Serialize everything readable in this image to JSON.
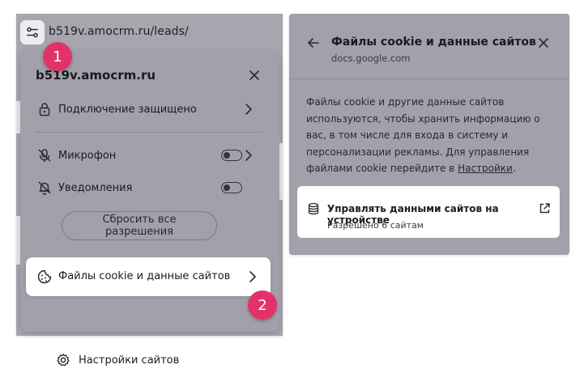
{
  "site_info": {
    "url": "b519v.amocrm.ru/leads/",
    "site_name": "b519v.amocrm.ru",
    "connection_label": "Подключение защищено",
    "permissions": [
      {
        "label": "Микрофон",
        "icon": "microphone-off-icon",
        "enabled": false
      },
      {
        "label": "Уведомления",
        "icon": "notifications-off-icon",
        "enabled": false
      }
    ],
    "reset_button": "Сбросить все разрешения",
    "cookies_label": "Файлы cookie и данные сайтов",
    "site_settings_label": "Настройки сайтов"
  },
  "steps": {
    "one": "1",
    "two": "2"
  },
  "cookie_panel": {
    "title": "Файлы cookie и данные сайтов",
    "subtitle": "docs.google.com",
    "description": "Файлы cookie и другие данные сайтов используются, чтобы хранить информацию о вас, в том числе для входа в систему и персонализации рекламы. Для управления файлами cookie перейдите в ",
    "settings_link": "Настройки",
    "description_end": ".",
    "manage": {
      "title": "Управлять данными сайтов на устройстве",
      "subtitle": "Разрешено 6 сайтам"
    }
  },
  "colors": {
    "panel_bg": "#a39fab",
    "step_badge": "#e3326a",
    "highlight_bg": "#ffffff"
  }
}
